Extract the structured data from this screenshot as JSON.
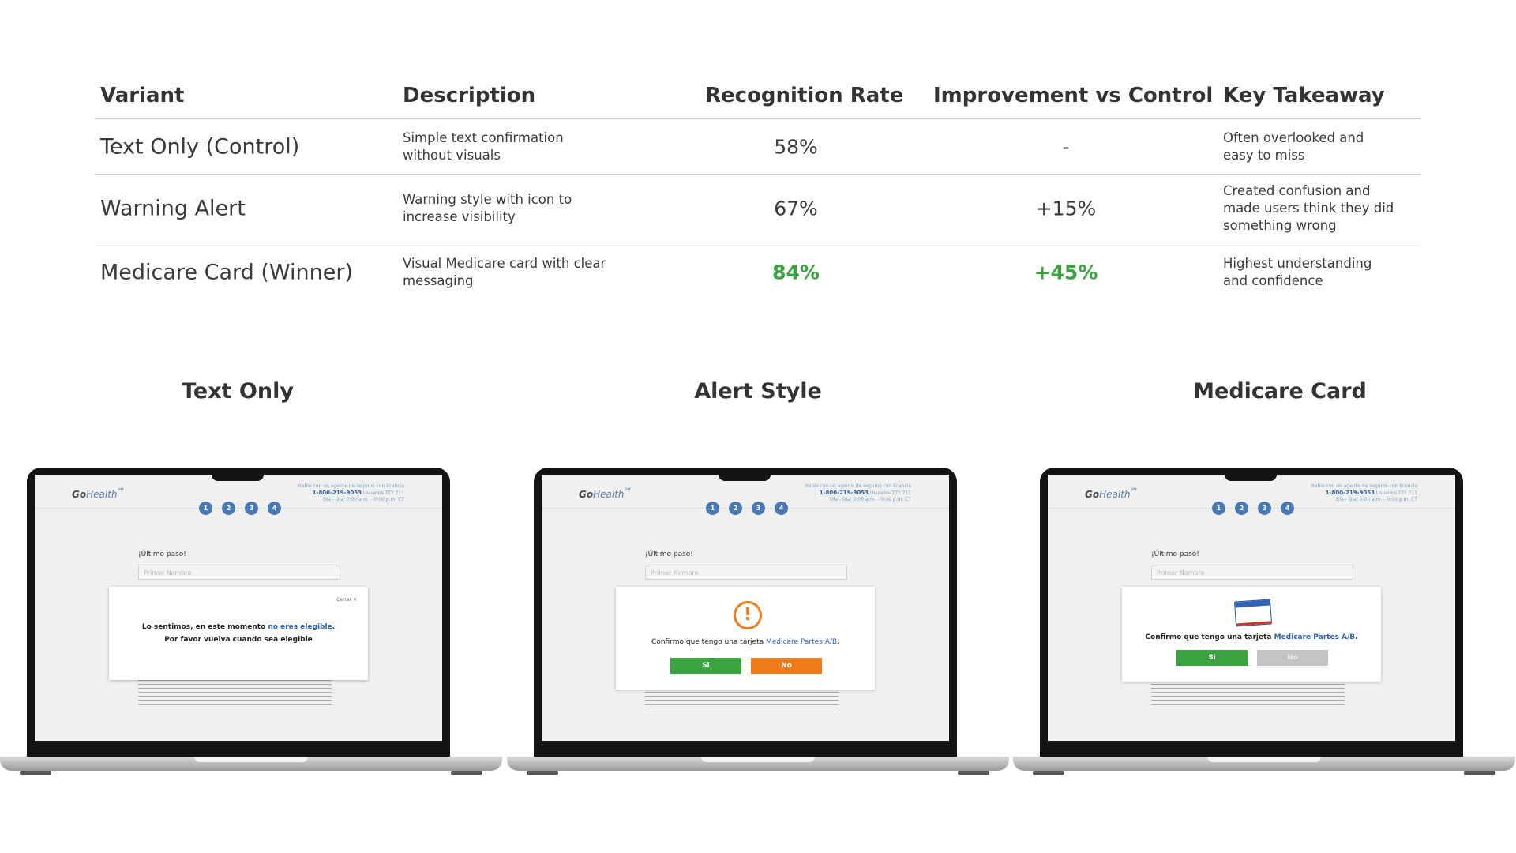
{
  "table": {
    "headers": [
      "Variant",
      "Description",
      "Recognition Rate",
      "Improvement vs Control",
      "Key Takeaway"
    ],
    "rows": [
      {
        "variant": "Text Only (Control)",
        "description": "Simple text confirmation without visuals",
        "rate": "58%",
        "improvement": "-",
        "takeaway": "Often overlooked and easy to miss",
        "winner": false
      },
      {
        "variant": "Warning Alert",
        "description": "Warning style with icon to increase visibility",
        "rate": "67%",
        "improvement": "+15%",
        "takeaway": "Created confusion and made users think they did something wrong",
        "winner": false
      },
      {
        "variant": "Medicare Card (Winner)",
        "description": "Visual Medicare card with clear messaging",
        "rate": "84%",
        "improvement": "+45%",
        "takeaway": "Highest understanding and confidence",
        "winner": true
      }
    ]
  },
  "colors": {
    "winner": "#3aa33f",
    "primary_blue": "#4a7ab5",
    "green_button": "#3aa33f",
    "orange_button": "#f07b1a"
  },
  "mockups": {
    "captions": [
      "Text Only",
      "Alert Style",
      "Medicare Card"
    ],
    "screen": {
      "logo_go": "Go",
      "logo_health": "Health",
      "logo_mark": "℠",
      "contact_line1": "Hable con un agente de seguros con licencia",
      "phone": "1-800-219-9053",
      "tty": "Usuarios TTY 711",
      "hours": "Día - Día, 0:00 a.m. - 0:00 p.m. CT",
      "steps": [
        "1",
        "2",
        "3",
        "4"
      ],
      "ultimo": "¡Último paso!",
      "field_placeholder": "Primer Nombre"
    },
    "text_only": {
      "close": "Cerrar",
      "line1_prefix": "Lo sentimos, en este momento ",
      "line1_link": "no eres elegible",
      "line1_suffix": ".",
      "line2": "Por favor vuelva cuando sea elegible"
    },
    "alert_style": {
      "icon": "alert-icon",
      "message_prefix": "Confirmo que tengo una tarjeta ",
      "message_link": "Medicare Partes A/B",
      "message_suffix": ".",
      "yes_label": "Si",
      "no_label": "No"
    },
    "medicare_card": {
      "icon": "medicare-card-icon",
      "message_prefix": "Confirmo que tengo una tarjeta ",
      "message_link": "Medicare Partes A/B",
      "message_suffix": ".",
      "yes_label": "Si",
      "no_label": "No"
    }
  }
}
